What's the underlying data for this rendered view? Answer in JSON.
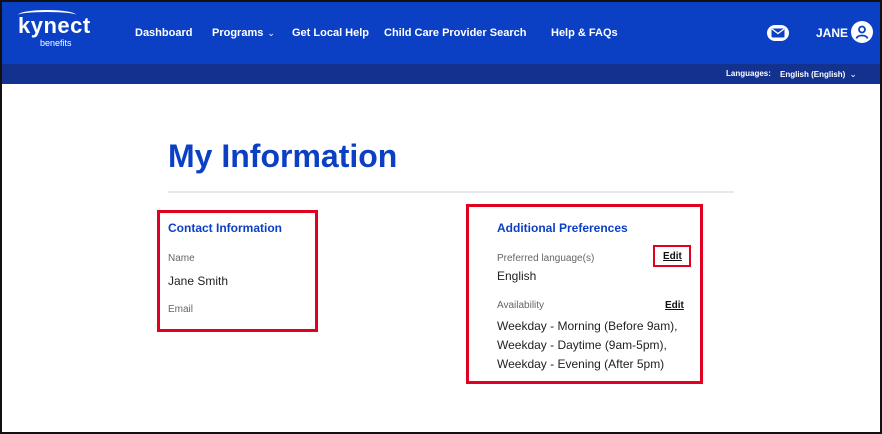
{
  "header": {
    "logo_main": "kynect",
    "logo_sub": "benefits",
    "nav": [
      "Dashboard",
      "Programs",
      "Get Local Help",
      "Child Care Provider Search",
      "Help & FAQs"
    ],
    "user_name": "JANE"
  },
  "language_bar": {
    "label": "Languages:",
    "value": "English (English)"
  },
  "page": {
    "title": "My Information"
  },
  "contact": {
    "heading": "Contact Information",
    "name_label": "Name",
    "name_value": "Jane Smith",
    "email_label": "Email"
  },
  "preferences": {
    "heading": "Additional Preferences",
    "language_label": "Preferred language(s)",
    "language_value": "English",
    "availability_label": "Availability",
    "availability_lines": [
      "Weekday - Morning (Before 9am),",
      "Weekday - Daytime (9am-5pm),",
      "Weekday - Evening (After 5pm)"
    ],
    "edit_label": "Edit"
  },
  "colors": {
    "nav_blue": "#0b3fc4",
    "lang_bar": "#13318f",
    "highlight_red": "#e1001f"
  }
}
